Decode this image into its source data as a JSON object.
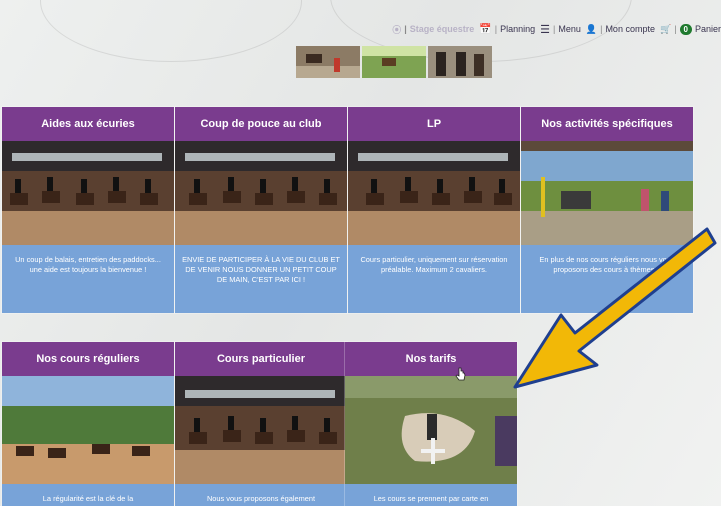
{
  "topbar": {
    "stage": "Stage équestre",
    "planning": "Planning",
    "menu": "Menu",
    "account": "Mon compte",
    "cart_count": "0",
    "cart": "Panier"
  },
  "cards_row1": [
    {
      "title": "Aides aux écuries",
      "text": "Un coup de balais, entretien des paddocks... une aide est toujours la bienvenue !"
    },
    {
      "title": "Coup de pouce au club",
      "text": "ENVIE DE PARTICIPER À LA VIE DU CLUB ET DE VENIR NOUS DONNER UN PETIT COUP DE MAIN, C'EST PAR ICI !"
    },
    {
      "title": "LP",
      "text": "Cours particulier, uniquement sur réservation préalable. Maximum 2 cavaliers."
    },
    {
      "title": "Nos activités spécifiques",
      "text": "En plus de nos cours réguliers nous vous proposons des cours à thèmes..."
    }
  ],
  "cards_row2": [
    {
      "title": "Nos cours réguliers",
      "text": "La régularité est la clé de la"
    },
    {
      "title": "Cours particulier",
      "text": "Nous vous proposons également"
    },
    {
      "title": "Nos tarifs",
      "text": "Les cours se prennent par carte en"
    }
  ],
  "colors": {
    "header": "#7a3c8e",
    "card_body": "#78a3d8",
    "arrow": "#f2b807"
  }
}
